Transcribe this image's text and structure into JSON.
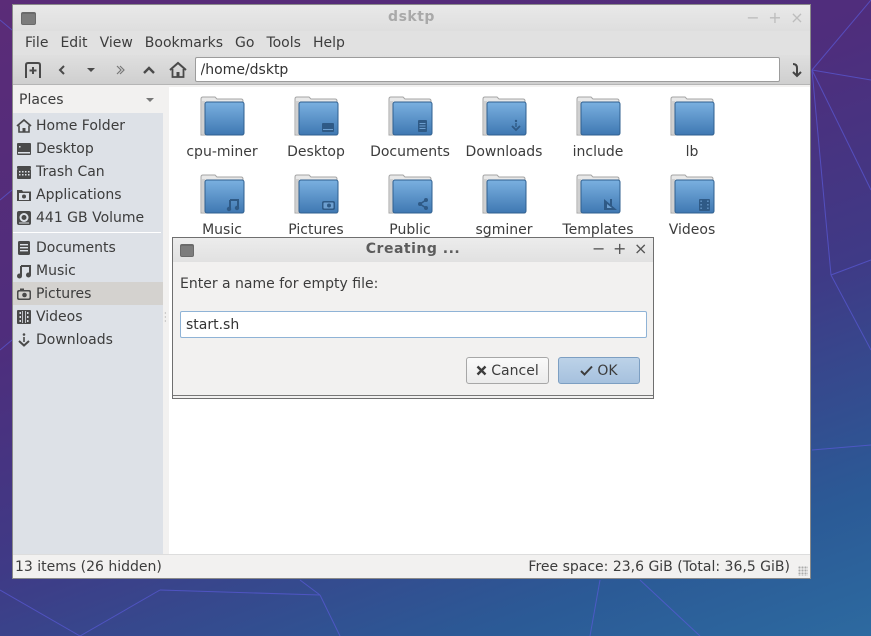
{
  "window": {
    "title": "dsktp",
    "controls": [
      "−",
      "+",
      "×"
    ]
  },
  "menubar": {
    "items": [
      "File",
      "Edit",
      "View",
      "Bookmarks",
      "Go",
      "Tools",
      "Help"
    ]
  },
  "toolbar": {
    "buttons": [
      "new-tab-icon",
      "back-icon",
      "history-dropdown-icon",
      "forward-icon",
      "up-icon",
      "home-icon"
    ],
    "path_value": "/home/dsktp",
    "go_icon": "go-icon"
  },
  "sidebar": {
    "header": "Places",
    "devices": [
      {
        "label": "Home Folder",
        "icon": "home-icon"
      },
      {
        "label": "Desktop",
        "icon": "desktop-icon"
      },
      {
        "label": "Trash Can",
        "icon": "trash-icon"
      },
      {
        "label": "Applications",
        "icon": "applications-icon"
      },
      {
        "label": "441 GB Volume",
        "icon": "drive-icon"
      }
    ],
    "bookmarks": [
      {
        "label": "Documents",
        "icon": "documents-icon",
        "selected": false
      },
      {
        "label": "Music",
        "icon": "music-icon",
        "selected": false
      },
      {
        "label": "Pictures",
        "icon": "camera-icon",
        "selected": true
      },
      {
        "label": "Videos",
        "icon": "video-icon",
        "selected": false
      },
      {
        "label": "Downloads",
        "icon": "download-icon",
        "selected": false
      }
    ]
  },
  "files": [
    {
      "name": "cpu-miner",
      "emblem": "none"
    },
    {
      "name": "Desktop",
      "emblem": "desktop"
    },
    {
      "name": "Documents",
      "emblem": "documents"
    },
    {
      "name": "Downloads",
      "emblem": "download"
    },
    {
      "name": "include",
      "emblem": "none"
    },
    {
      "name": "lb",
      "emblem": "none"
    },
    {
      "name": "Music",
      "emblem": "music"
    },
    {
      "name": "Pictures",
      "emblem": "camera"
    },
    {
      "name": "Public",
      "emblem": "share"
    },
    {
      "name": "sgminer",
      "emblem": "none"
    },
    {
      "name": "Templates",
      "emblem": "templates"
    },
    {
      "name": "Videos",
      "emblem": "video"
    }
  ],
  "statusbar": {
    "items": "13 items (26 hidden)",
    "free_space": "Free space: 23,6 GiB (Total: 36,5 GiB)"
  },
  "dialog": {
    "title": "Creating ...",
    "controls": [
      "−",
      "+",
      "×"
    ],
    "prompt": "Enter a name for empty file:",
    "input_value": "start.sh",
    "cancel_label": "Cancel",
    "ok_label": "OK"
  },
  "colors": {
    "folder_blue": "#4f86bf",
    "selection_bg": "#d4d2cf",
    "sidebar_bg": "#dde1e7",
    "ok_button": "#a6c1de"
  }
}
